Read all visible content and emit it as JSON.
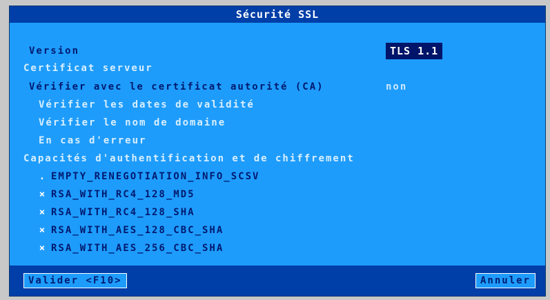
{
  "window": {
    "title": "Sécurité SSL"
  },
  "version": {
    "label": "Version",
    "value": "TLS 1.1"
  },
  "server_certificate": {
    "heading": "Certificat serveur",
    "verify_ca_label": "Vérifier avec le certificat autorité (CA)",
    "verify_ca_value": "non",
    "verify_dates_label": "Vérifier les dates de validité",
    "verify_domain_label": "Vérifier le nom de domaine",
    "on_error_label": "En cas d'erreur"
  },
  "capabilities": {
    "heading": "Capacités d'authentification et de chiffrement",
    "items": [
      {
        "mark": ".",
        "name": "EMPTY_RENEGOTIATION_INFO_SCSV"
      },
      {
        "mark": "×",
        "name": "RSA_WITH_RC4_128_MD5"
      },
      {
        "mark": "×",
        "name": "RSA_WITH_RC4_128_SHA"
      },
      {
        "mark": "×",
        "name": "RSA_WITH_AES_128_CBC_SHA"
      },
      {
        "mark": "×",
        "name": "RSA_WITH_AES_256_CBC_SHA"
      }
    ]
  },
  "buttons": {
    "validate": "Valider <F10>",
    "cancel": "Annuler"
  },
  "colors": {
    "dialog_background": "#1e9cfc",
    "title_bar": "#003ea8",
    "selected_value_background": "#00146a",
    "active_text": "#001a6e",
    "inactive_text": "#d9efff"
  }
}
